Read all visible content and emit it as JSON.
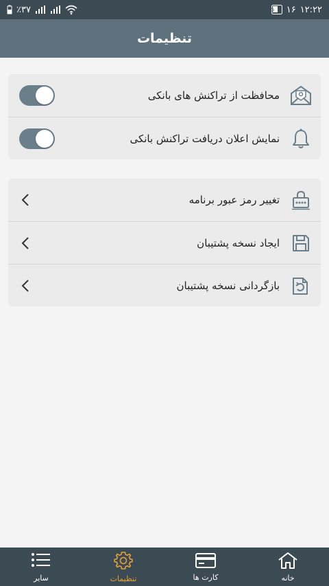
{
  "status_bar": {
    "battery": "٪۳۷",
    "time": "۱۲:۲۲",
    "date": "۱۶"
  },
  "header": {
    "title": "تنظیمات"
  },
  "security_card": {
    "items": [
      {
        "label": "محافظت از تراکنش های بانکی",
        "icon": "envelope-shield-icon",
        "toggle_on": true
      },
      {
        "label": "نمایش اعلان دریافت تراکنش بانکی",
        "icon": "bell-icon",
        "toggle_on": true
      }
    ]
  },
  "actions_card": {
    "items": [
      {
        "label": "تغییر رمز عبور برنامه",
        "icon": "password-lock-icon"
      },
      {
        "label": "ایجاد نسخه پشتیبان",
        "icon": "floppy-disk-icon"
      },
      {
        "label": "بازگردانی نسخه پشتیبان",
        "icon": "restore-file-icon"
      }
    ]
  },
  "bottom_nav": {
    "items": [
      {
        "label": "سایر",
        "icon": "menu-list-icon",
        "active": false
      },
      {
        "label": "تنظیمات",
        "icon": "gear-icon",
        "active": true
      },
      {
        "label": "کارت ها",
        "icon": "credit-card-icon",
        "active": false
      },
      {
        "label": "خانه",
        "icon": "home-icon",
        "active": false
      }
    ]
  },
  "colors": {
    "status_bar": "#3c4a54",
    "app_bar": "#5e717d",
    "toggle_track": "#6b7f8b",
    "active_nav": "#e8a23a"
  }
}
